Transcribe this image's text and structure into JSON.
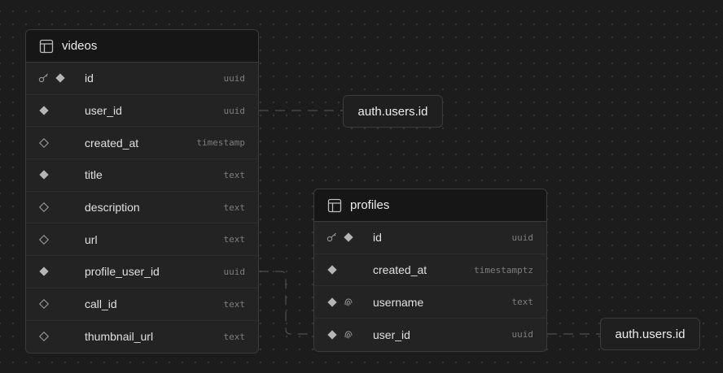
{
  "tables": {
    "videos": {
      "title": "videos",
      "columns": [
        {
          "name": "id",
          "type": "uuid",
          "key": true,
          "nullable": false,
          "identity": false
        },
        {
          "name": "user_id",
          "type": "uuid",
          "key": false,
          "nullable": false,
          "identity": false
        },
        {
          "name": "created_at",
          "type": "timestamp",
          "key": false,
          "nullable": true,
          "identity": false
        },
        {
          "name": "title",
          "type": "text",
          "key": false,
          "nullable": false,
          "identity": false
        },
        {
          "name": "description",
          "type": "text",
          "key": false,
          "nullable": true,
          "identity": false
        },
        {
          "name": "url",
          "type": "text",
          "key": false,
          "nullable": true,
          "identity": false
        },
        {
          "name": "profile_user_id",
          "type": "uuid",
          "key": false,
          "nullable": false,
          "identity": false
        },
        {
          "name": "call_id",
          "type": "text",
          "key": false,
          "nullable": true,
          "identity": false
        },
        {
          "name": "thumbnail_url",
          "type": "text",
          "key": false,
          "nullable": true,
          "identity": false
        }
      ]
    },
    "profiles": {
      "title": "profiles",
      "columns": [
        {
          "name": "id",
          "type": "uuid",
          "key": true,
          "nullable": false,
          "identity": false
        },
        {
          "name": "created_at",
          "type": "timestamptz",
          "key": false,
          "nullable": false,
          "identity": false
        },
        {
          "name": "username",
          "type": "text",
          "key": false,
          "nullable": false,
          "identity": true
        },
        {
          "name": "user_id",
          "type": "uuid",
          "key": false,
          "nullable": false,
          "identity": true
        }
      ]
    }
  },
  "references": {
    "ref1": {
      "label": "auth.users.id"
    },
    "ref2": {
      "label": "auth.users.id"
    }
  },
  "colors": {
    "background": "#1c1c1c",
    "table_bg": "#232323",
    "header_bg": "#161616",
    "border": "#3b3b3b",
    "edge": "#5a5a5a"
  }
}
